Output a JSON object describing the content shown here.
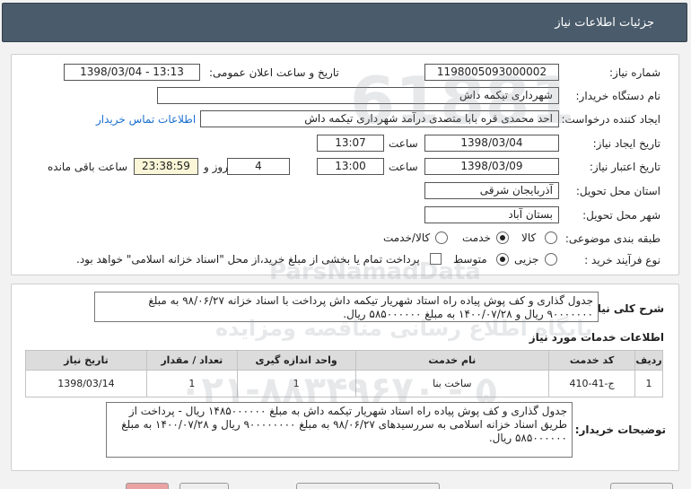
{
  "header": {
    "title": "جزئیات اطلاعات نیاز"
  },
  "fields": {
    "need_number_label": "شماره نیاز:",
    "need_number": "1198005093000002",
    "announce_label": "تاریخ و ساعت اعلان عمومی:",
    "announce_value": "1398/03/04 - 13:13",
    "buyer_org_label": "نام دستگاه خریدار:",
    "buyer_org": "شهرداری تیکمه داش",
    "creator_label": "ایجاد کننده درخواست:",
    "creator": "احد محمدی قره بابا متصدی درآمد  شهرداری تیکمه داش",
    "contact_link": "اطلاعات تماس خریدار",
    "created_date_label": "تاریخ ایجاد نیاز:",
    "created_date": "1398/03/04",
    "time_label": "ساعت",
    "created_time": "13:07",
    "validity_label": "تاریخ اعتبار نیاز:",
    "validity_date": "1398/03/09",
    "validity_time": "13:00",
    "days_value": "4",
    "days_label": "روز و",
    "remaining_time": "23:38:59",
    "remaining_label": "ساعت باقی مانده",
    "province_label": "استان محل تحویل:",
    "province": "آذربایجان شرقی",
    "city_label": "شهر محل تحویل:",
    "city": "بستان آباد",
    "category_label": "طبقه بندی موضوعی:",
    "category_options": [
      "کالا",
      "خدمت",
      "کالا/خدمت"
    ],
    "process_label": "نوع فرآیند خرید :",
    "process_options": [
      "جزیی",
      "متوسط"
    ],
    "payment_note": "پرداخت تمام یا بخشی از مبلغ خرید،از محل \"اسناد خزانه اسلامی\" خواهد بود."
  },
  "general_desc": {
    "label": "شرح کلی نیاز:",
    "text": "جدول گذاری و کف پوش پیاده راه استاد شهریار تیکمه داش پرداخت با اسناد خزانه  ۹۸/۰۶/۲۷ به مبلغ ۹۰۰۰۰۰۰۰ ریال و ۱۴۰۰/۰۷/۲۸ به مبلغ ۵۸۵۰۰۰۰۰۰ ریال."
  },
  "services": {
    "title": "اطلاعات خدمات مورد نیاز",
    "headers": [
      "ردیف",
      "کد خدمت",
      "نام خدمت",
      "واحد اندازه گیری",
      "تعداد / مقدار",
      "تاریخ نیاز"
    ],
    "rows": [
      [
        "1",
        "ج-41-410",
        "ساخت بنا",
        "1",
        "1",
        "1398/03/14"
      ]
    ]
  },
  "buyer_desc": {
    "label": "توضیحات خریدار:",
    "text": "جدول گذاری و کف پوش پیاده راه استاد شهریار تیکمه داش به مبلغ ۱۴۸۵۰۰۰۰۰۰ ریال - پرداخت از طریق اسناد خزانه اسلامی به سررسیدهای ۹۸/۰۶/۲۷ به مبلغ ۹۰۰۰۰۰۰۰۰ ریال و ۱۴۰۰/۰۷/۲۸ به مبلغ ۵۸۵۰۰۰۰۰۰ ریال."
  },
  "watermark": {
    "name": "ParsNamadData",
    "fa_line": "پایگاه اطلاع رسانی مناقصه ومزایده",
    "phone": "۰۲۱-۸۸۳۴۹۶۷۰ - ۵"
  }
}
